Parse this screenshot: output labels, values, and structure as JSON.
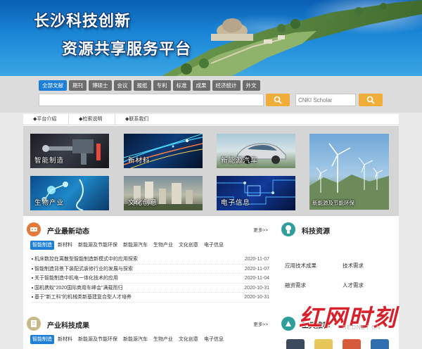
{
  "banner": {
    "title_line1": "长沙科技创新",
    "title_line2": "资源共享服务平台"
  },
  "search": {
    "tabs": [
      "全部文献",
      "期刊",
      "博硕士",
      "会议",
      "报纸",
      "专利",
      "标准",
      "成果",
      "经济统计",
      "外文"
    ],
    "active_tab": "全部文献",
    "query": "",
    "scholar_placeholder": "CNKI Scholar"
  },
  "subnav": [
    "◆平台介绍",
    "◆检索说明",
    "◆联系我们"
  ],
  "tiles": [
    {
      "label": "智能制造"
    },
    {
      "label": "新材料"
    },
    {
      "label": "新能源汽车"
    },
    {
      "label": "生物产业"
    },
    {
      "label": "文化创意"
    },
    {
      "label": "电子信息"
    },
    {
      "label": "新能源及节能环保"
    }
  ],
  "industry_news": {
    "title": "产业最新动态",
    "more": "更多>>",
    "tabs": [
      "智能制造",
      "新材料",
      "新能源及节能环保",
      "新能源汽车",
      "生物产业",
      "文化创意",
      "电子信息"
    ],
    "items": [
      {
        "title": "机床数控在离散型智能制造新模式中的应用探索",
        "date": "2020-11-07"
      },
      {
        "title": "智能制造背景下装配式装修行业的发展与探索",
        "date": "2020-11-07"
      },
      {
        "title": "关于智能制造中机电一体化技术的应用",
        "date": "2020-11-04"
      },
      {
        "title": "国机携蚁\"2020国际商用车峰会\"满载而归",
        "date": "2020-10-31"
      },
      {
        "title": "基于\"新工科\"的机械类新基建复合型人才培养",
        "date": "2020-10-31"
      }
    ]
  },
  "tech_resources": {
    "title": "科技资源",
    "links": [
      "应用技术成果",
      "技术需求",
      "融资需求",
      "人才需求"
    ]
  },
  "tech_results": {
    "title": "产业科技成果",
    "more": "更多>>",
    "tabs": [
      "智能制造",
      "新材料",
      "新能源及节能环保",
      "新能源汽车",
      "生物产业",
      "文化创意",
      "电子信息"
    ]
  },
  "tools": {
    "title": "工具推荐"
  },
  "watermark": {
    "brand": "红网时刻",
    "url": "REDNET.CN"
  },
  "colors": {
    "accent_blue": "#1d7fd8",
    "search_button": "#f0ad3a",
    "tab_gray": "#6c6c6c",
    "watermark_red": "#d8202a"
  }
}
